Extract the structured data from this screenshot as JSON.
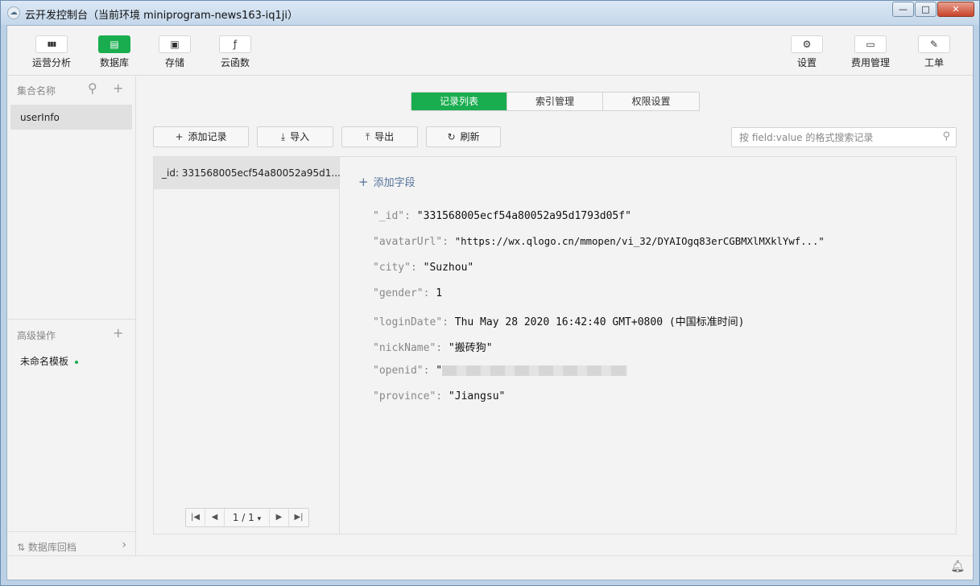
{
  "window": {
    "title": "云开发控制台（当前环境 miniprogram-news163-iq1ji）",
    "minimize": "—",
    "maximize": "□",
    "close": "✕"
  },
  "toolbar": {
    "left": [
      {
        "label": "运营分析",
        "icon": "bar-chart-icon",
        "glyph": "▮▮▮",
        "active": false
      },
      {
        "label": "数据库",
        "icon": "database-icon",
        "glyph": "▤",
        "active": true
      },
      {
        "label": "存储",
        "icon": "storage-icon",
        "glyph": "▣",
        "active": false
      },
      {
        "label": "云函数",
        "icon": "function-icon",
        "glyph": "ƒ",
        "active": false
      }
    ],
    "right": [
      {
        "label": "设置",
        "icon": "gear-icon",
        "glyph": "⚙"
      },
      {
        "label": "费用管理",
        "icon": "billing-icon",
        "glyph": "▭"
      },
      {
        "label": "工单",
        "icon": "ticket-icon",
        "glyph": "✎"
      }
    ]
  },
  "sidebar": {
    "collection_header": "集合名称",
    "collections": [
      "userInfo"
    ],
    "advanced_header": "高级操作",
    "templates": [
      "未命名模板"
    ],
    "footer": "数据库回档"
  },
  "main": {
    "tabs": [
      {
        "label": "记录列表",
        "active": true
      },
      {
        "label": "索引管理",
        "active": false
      },
      {
        "label": "权限设置",
        "active": false
      }
    ],
    "actions": {
      "add": "添加记录",
      "import": "导入",
      "export": "导出",
      "refresh": "刷新"
    },
    "search": {
      "placeholder": "按 field:value 的格式搜索记录"
    },
    "records": [
      "_id: 331568005ecf54a80052a95d1..."
    ],
    "pager": {
      "page": "1 / 1"
    },
    "add_field": "添加字段",
    "fields": [
      {
        "key": "\"_id\":",
        "value": "\"331568005ecf54a80052a95d1793d05f\""
      },
      {
        "key": "\"avatarUrl\":",
        "value": "\"https://wx.qlogo.cn/mmopen/vi_32/DYAIOgq83erCGBMXlMXklYwf...\""
      },
      {
        "key": "\"city\":",
        "value": "\"Suzhou\""
      },
      {
        "key": "\"gender\":",
        "value": "1"
      },
      {
        "key": "\"loginDate\":",
        "value": "Thu May 28 2020 16:42:40 GMT+0800 (中国标准时间)"
      },
      {
        "key": "\"nickName\":",
        "value": "\"搬砖狗\""
      },
      {
        "key": "\"openid\":",
        "value": "\""
      },
      {
        "key": "\"province\":",
        "value": "\"Jiangsu\""
      }
    ]
  },
  "colors": {
    "accent": "#1aad4f",
    "link": "#55749c"
  }
}
